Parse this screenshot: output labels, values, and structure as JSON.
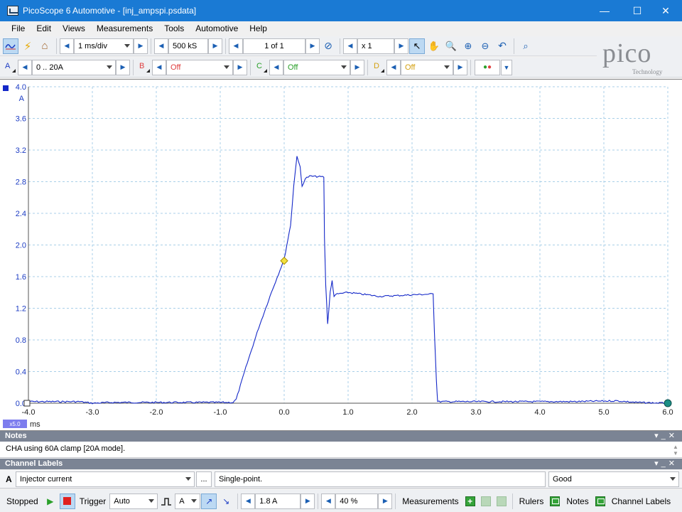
{
  "window": {
    "title": "PicoScope 6 Automotive - [inj_ampspi.psdata]",
    "controls": {
      "minimize": "—",
      "maximize": "☐",
      "close": "✕"
    }
  },
  "menu": [
    "File",
    "Edit",
    "Views",
    "Measurements",
    "Tools",
    "Automotive",
    "Help"
  ],
  "toolbar1": {
    "timebase": "1 ms/div",
    "samples": "500 kS",
    "buffer": "1 of 1",
    "zoom": "x 1"
  },
  "toolbar2": {
    "channels": [
      {
        "letter": "A",
        "range": "0 .. 20A",
        "color": "#1c3cc4"
      },
      {
        "letter": "B",
        "range": "Off",
        "color": "#e04040"
      },
      {
        "letter": "C",
        "range": "Off",
        "color": "#2aa02a"
      },
      {
        "letter": "D",
        "range": "Off",
        "color": "#d4a010"
      }
    ]
  },
  "logo": {
    "word": "pico",
    "sub": "Technology"
  },
  "chart_data": {
    "type": "line",
    "xlabel": "ms",
    "ylabel": "A",
    "xlim": [
      -4.0,
      6.0
    ],
    "ylim": [
      0.0,
      4.0
    ],
    "x_ticks": [
      "-4.0",
      "-3.0",
      "-2.0",
      "-1.0",
      "0.0",
      "1.0",
      "2.0",
      "3.0",
      "4.0",
      "5.0",
      "6.0"
    ],
    "y_ticks": [
      "0.0",
      "0.4",
      "0.8",
      "1.2",
      "1.6",
      "2.0",
      "2.4",
      "2.8",
      "3.2",
      "3.6",
      "4.0"
    ],
    "x_zoom_badge": "x5.0",
    "grid": true,
    "trigger_point": {
      "x": 0.0,
      "y": 1.8
    },
    "series": [
      {
        "color": "#1428c8",
        "points": [
          [
            -4.0,
            0.02
          ],
          [
            -3.2,
            0.02
          ],
          [
            -3.0,
            0.0
          ],
          [
            -2.7,
            0.01
          ],
          [
            -0.8,
            0.01
          ],
          [
            -0.75,
            0.05
          ],
          [
            -0.6,
            0.45
          ],
          [
            -0.4,
            0.95
          ],
          [
            -0.2,
            1.4
          ],
          [
            0.0,
            1.82
          ],
          [
            0.1,
            2.25
          ],
          [
            0.15,
            2.75
          ],
          [
            0.2,
            3.13
          ],
          [
            0.25,
            2.98
          ],
          [
            0.28,
            2.74
          ],
          [
            0.33,
            2.84
          ],
          [
            0.4,
            2.87
          ],
          [
            0.62,
            2.86
          ],
          [
            0.63,
            2.1
          ],
          [
            0.65,
            1.5
          ],
          [
            0.68,
            1.0
          ],
          [
            0.72,
            1.4
          ],
          [
            0.75,
            1.55
          ],
          [
            0.78,
            1.35
          ],
          [
            0.83,
            1.38
          ],
          [
            1.0,
            1.4
          ],
          [
            1.5,
            1.35
          ],
          [
            2.0,
            1.37
          ],
          [
            2.33,
            1.38
          ],
          [
            2.35,
            0.9
          ],
          [
            2.38,
            0.3
          ],
          [
            2.4,
            0.02
          ],
          [
            3.0,
            0.02
          ],
          [
            4.5,
            0.02
          ],
          [
            5.2,
            0.03
          ],
          [
            5.5,
            0.01
          ],
          [
            6.0,
            0.0
          ]
        ]
      }
    ]
  },
  "notes": {
    "header": "Notes",
    "text": "CHA using 60A clamp [20A mode]."
  },
  "channel_labels": {
    "header": "Channel Labels",
    "channel": "A",
    "label": "Injector current",
    "ellipsis": "...",
    "description": "Single-point.",
    "status": "Good"
  },
  "status": {
    "run_state": "Stopped",
    "trigger_label": "Trigger",
    "trigger_mode": "Auto",
    "trigger_channel": "A",
    "trigger_level": "1.8 A",
    "pre_trigger": "40 %",
    "measurements": "Measurements",
    "rulers": "Rulers",
    "notes": "Notes",
    "channel_labels": "Channel Labels"
  }
}
